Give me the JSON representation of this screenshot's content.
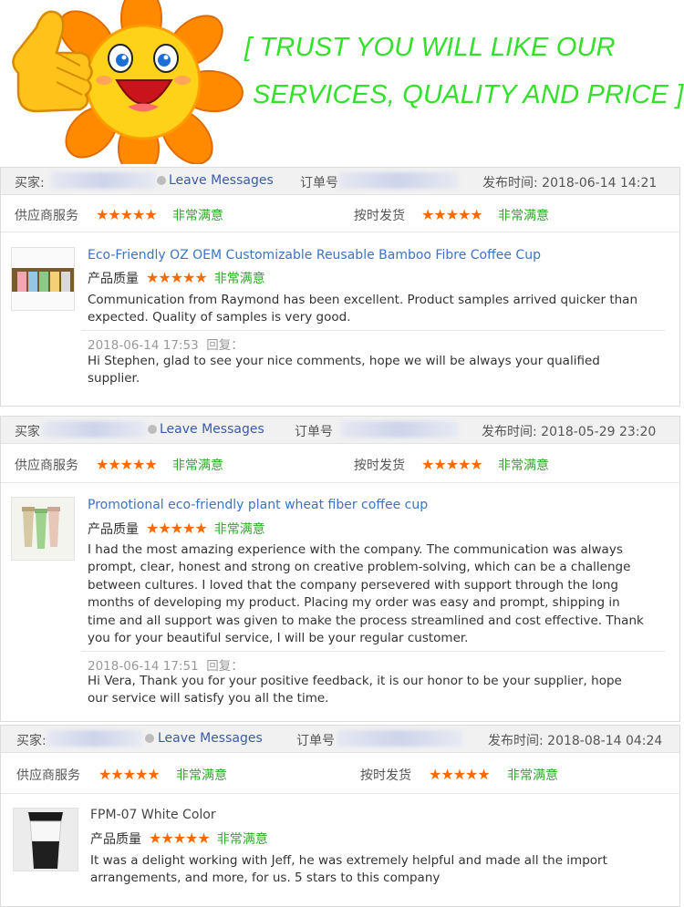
{
  "banner": {
    "line1": "[ TRUST YOU WILL LIKE OUR",
    "line2": "SERVICES, QUALITY AND PRICE ]",
    "color": "#33e02a"
  },
  "labels": {
    "buyer": "买家:",
    "leave_messages": "Leave Messages",
    "order_no": "订单号",
    "published": "发布时间:",
    "supplier_service": "供应商服务",
    "on_time_delivery": "按时发货",
    "product_quality": "产品质量",
    "very_satisfied": "非常满意",
    "reply": "回复：",
    "stars": "★★★★★"
  },
  "reviews": [
    {
      "published_time": "2018-06-14 14:21",
      "product_title": "Eco-Friendly OZ OEM Customizable Reusable Bamboo Fibre Coffee Cup",
      "comment": "Communication from Raymond has been excellent. Product samples arrived quicker than expected. Quality of samples is very good.",
      "reply_time": "2018-06-14 17:53",
      "reply_text": "Hi Stephen, glad to see your nice comments, hope we will be always your qualified supplier."
    },
    {
      "buyer_label": "买家",
      "published_time": "2018-05-29 23:20",
      "product_title": "Promotional eco-friendly plant wheat fiber coffee cup",
      "comment": "I had the most amazing experience with the company. The communication was always prompt, clear, honest and strong on creative problem-solving, which can be a challenge between cultures. I loved that the company persevered with support through the long months of developing my product. Placing my order was easy and prompt, shipping in time and all support was given to make the process streamlined and cost effective. Thank you for your beautiful service, I will be your regular customer.",
      "reply_time": "2018-06-14 17:51",
      "reply_text": "Hi Vera, Thank you for your positive feedback, it is our honor to be your supplier, hope our service will satisfy you all the time."
    },
    {
      "published_time": "2018-08-14 04:24",
      "product_title": "FPM-07 White Color",
      "comment": "It was a delight working with Jeff, he was extremely helpful and made all the import arrangements, and more, for us. 5 stars to this company"
    }
  ]
}
